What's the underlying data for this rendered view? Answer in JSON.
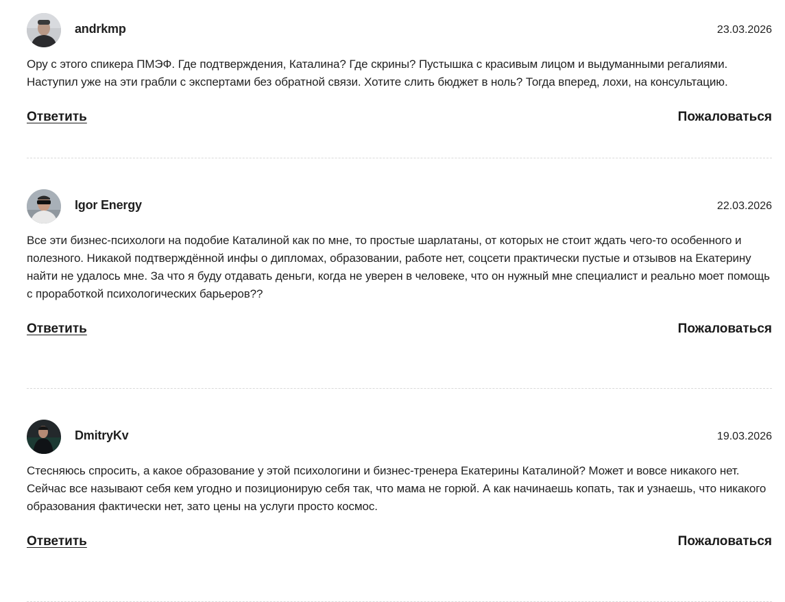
{
  "comments": [
    {
      "author": "andrkmp",
      "date": "23.03.2026",
      "text": "Ору с этого спикера ПМЭФ. Где подтверждения, Каталина? Где скрины? Пустышка с красивым лицом и выдуманными регалиями. Наступил уже на эти грабли с экспертами без обратной связи. Хотите слить бюджет в ноль? Тогда вперед, лохи, на консультацию.",
      "reply_label": "Ответить",
      "report_label": "Пожаловаться"
    },
    {
      "author": "Igor Energy",
      "date": "22.03.2026",
      "text": "Все эти бизнес-психологи на подобие Каталиной как по мне, то простые шарлатаны, от которых не стоит ждать чего-то особенного и полезного. Никакой подтверждённой инфы о дипломах, образовании, работе нет, соцсети практически пустые и отзывов на Екатерину найти не удалось мне. За что я буду отдавать деньги, когда не уверен в человеке, что он нужный мне специалист и реально моет помощь с проработкой психологических барьеров??",
      "reply_label": "Ответить",
      "report_label": "Пожаловаться"
    },
    {
      "author": "DmitryKv",
      "date": "19.03.2026",
      "text": "Стесняюсь спросить, а какое образование у этой психологини и бизнес-тренера Екатерины Каталиной? Может и вовсе никакого нет. Сейчас все называют себя кем угодно и позиционирую себя так, что мама не горюй. А как начинаешь копать, так и узнаешь, что никакого образования фактически нет, зато цены на услуги просто космос.",
      "reply_label": "Ответить",
      "report_label": "Пожаловаться"
    }
  ]
}
